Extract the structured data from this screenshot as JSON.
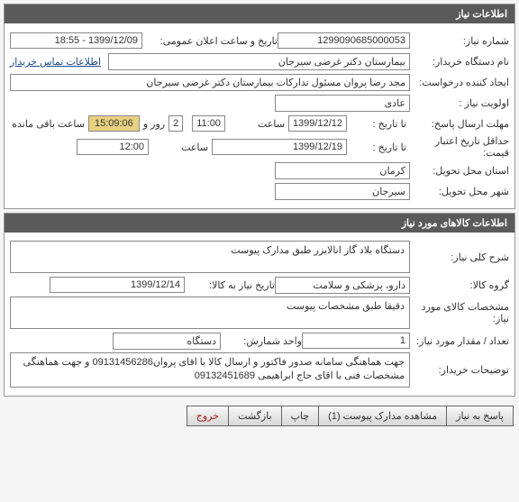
{
  "panel1": {
    "title": "اطلاعات نیاز",
    "need_number_label": "شماره نیاز:",
    "need_number": "1299090685000053",
    "announce_datetime_label": "تاریخ و ساعت اعلان عمومی:",
    "announce_datetime": "1399/12/09 - 18:55",
    "buyer_label": "نام دستگاه خریدار:",
    "buyer": "بیمارستان دکتر غرضی سیرجان",
    "contact_link": "اطلاعات تماس خریدار",
    "requester_label": "ایجاد کننده درخواست:",
    "requester": "مجد رضا پروان مسئول تدارکات بیمارستان دکتر غرضی سیرجان",
    "priority_label": "اولویت نیاز :",
    "priority": "عادی",
    "deadline_label": "مهلت ارسال پاسخ:",
    "until_label": "تا تاریخ :",
    "deadline_date": "1399/12/12",
    "time_label": "ساعت",
    "deadline_time": "11:00",
    "days_remaining": "2",
    "days_label": "روز و",
    "timer": "15:09:06",
    "timer_suffix": "ساعت باقی مانده",
    "min_validity_label": "حداقل تاریخ اعتبار قیمت:",
    "validity_date": "1399/12/19",
    "validity_time": "12:00",
    "delivery_province_label": "استان محل تحویل:",
    "delivery_province": "کرمان",
    "delivery_city_label": "شهر محل تحویل:",
    "delivery_city": "سیرجان"
  },
  "panel2": {
    "title": "اطلاعات کالاهای مورد نیاز",
    "desc_label": "شرح کلی نیاز:",
    "desc": "دستگاه بلاد گاز انالایزر  طبق مدارک پیوست",
    "group_label": "گروه کالا:",
    "group": "دارو، پزشکی و سلامت",
    "need_goods_date_label": "تاریخ نیاز به کالا:",
    "need_goods_date": "1399/12/14",
    "spec_label": "مشخصات کالای مورد نیاز:",
    "spec": "دقیقا طبق مشخصات پیوست",
    "qty_label": "تعداد / مقدار مورد نیاز:",
    "qty": "1",
    "unit_label": "واحد شمارش:",
    "unit": "دستگاه",
    "buyer_notes_label": "توضیحات خریدار:",
    "buyer_notes": "جهت هماهنگی سامانه صدور فاکتور و ارسال کالا با اقای پروان09131456286 و جهت هماهنگی مشخصات فنی با اقای حاج ابراهیمی 09132451689"
  },
  "actions": {
    "respond": "پاسخ به نیاز",
    "view_docs": "مشاهده مدارک پیوست  (1)",
    "print": "چاپ",
    "back": "بازگشت",
    "exit": "خروج"
  }
}
